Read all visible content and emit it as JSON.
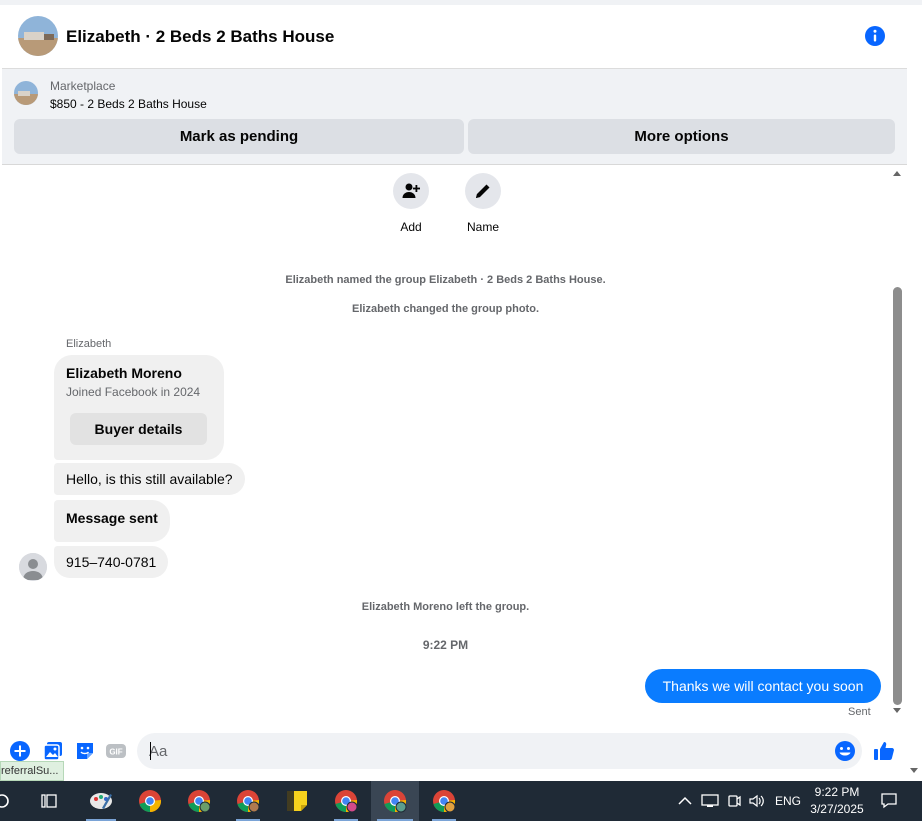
{
  "header": {
    "title": "Elizabeth · 2 Beds 2 Baths House"
  },
  "marketplace": {
    "kicker": "Marketplace",
    "listing": "$850 - 2 Beds 2 Baths House",
    "mark_pending_label": "Mark as pending",
    "more_options_label": "More options"
  },
  "chat": {
    "actions": [
      {
        "label": "Add"
      },
      {
        "label": "Name"
      }
    ],
    "system_messages": [
      "Elizabeth named the group Elizabeth · 2 Beds 2 Baths House.",
      "Elizabeth changed the group photo.",
      "Elizabeth Moreno left the group."
    ],
    "sender_name": "Elizabeth",
    "profile_card": {
      "name": "Elizabeth Moreno",
      "subtitle": "Joined Facebook in 2024",
      "button_label": "Buyer details"
    },
    "incoming_messages": [
      "Hello, is this still available?",
      "Message sent",
      "915–740-0781"
    ],
    "timestamp": "9:22 PM",
    "outgoing_message": "Thanks we will contact you soon",
    "outgoing_status": "Sent"
  },
  "composer": {
    "placeholder": "Aa",
    "gif_label": "GIF"
  },
  "tooltip": {
    "text": "referralSu..."
  },
  "taskbar": {
    "language": "ENG",
    "time": "9:22 PM",
    "date": "3/27/2025"
  },
  "colors": {
    "accent": "#0a7cff",
    "icon_blue": "#0866ff",
    "bubble_grey": "#f0f0f0",
    "taskbar": "#1f2a36"
  }
}
